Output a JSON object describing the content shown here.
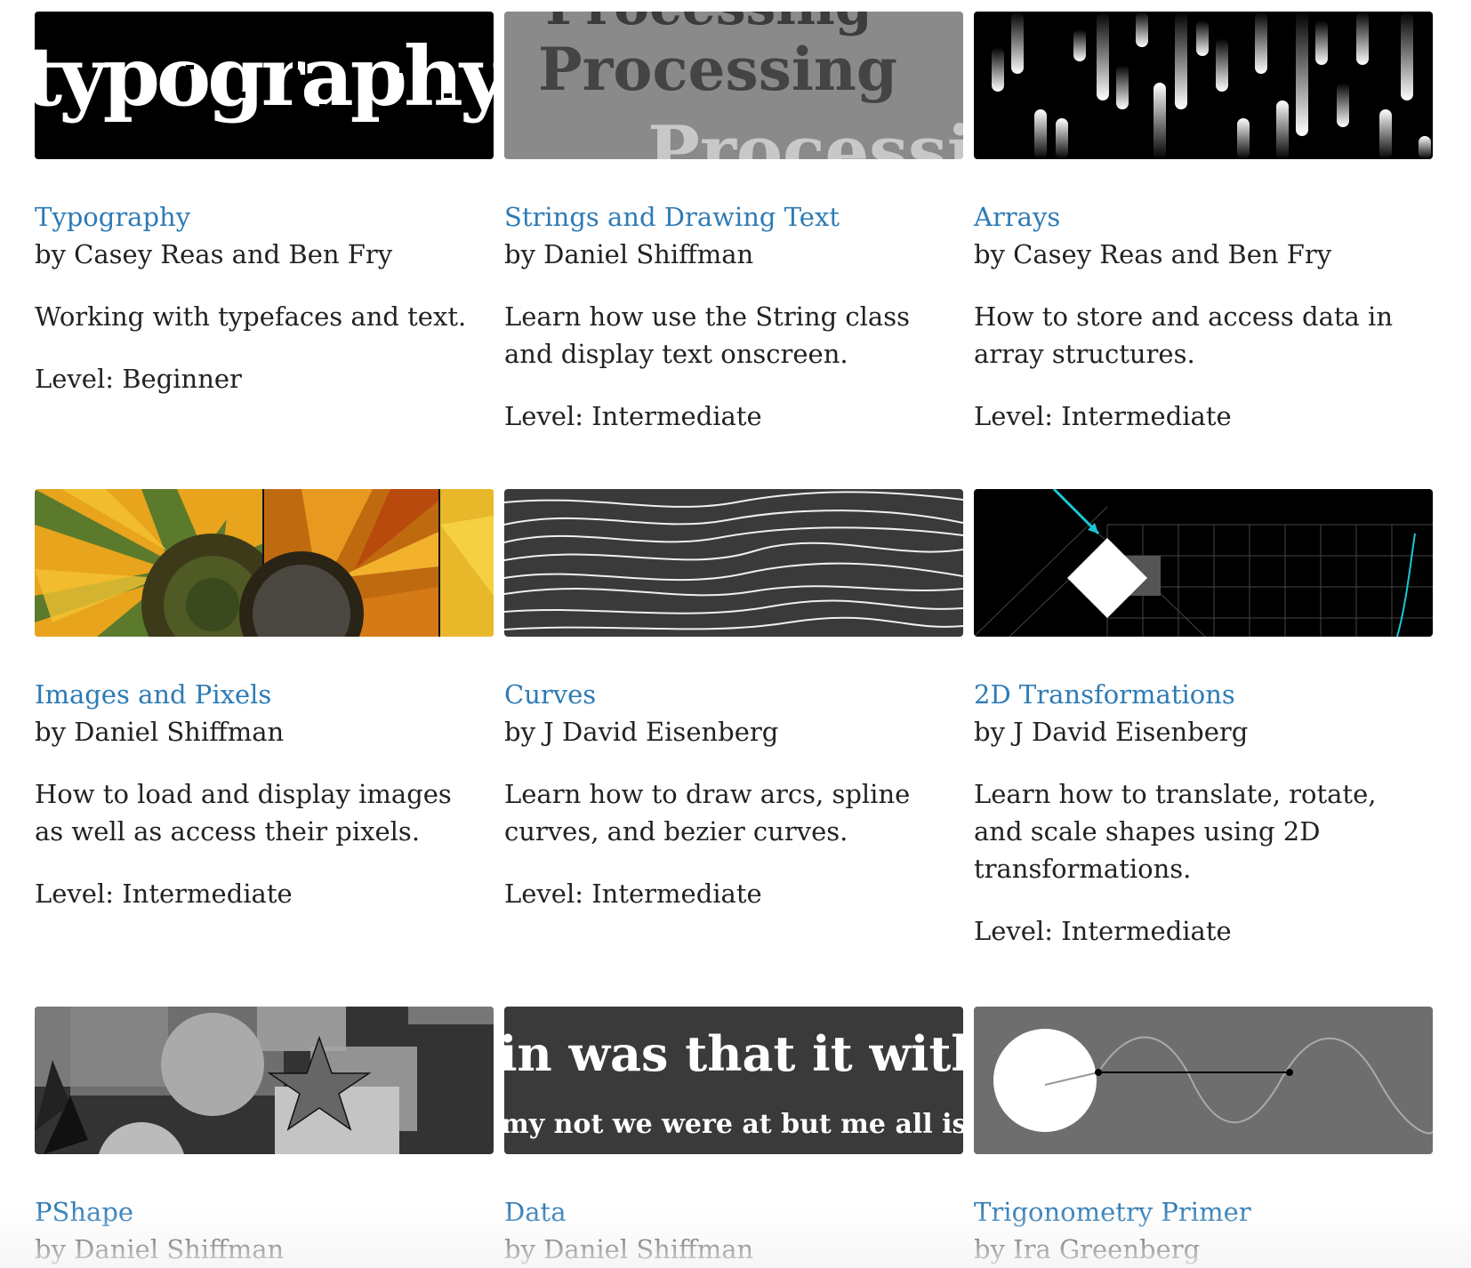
{
  "tutorials": [
    {
      "title": "Typography",
      "author": "by Casey Reas and Ben Fry",
      "description": "Working with typefaces and text.",
      "level": "Level: Beginner",
      "thumb_text": "typography"
    },
    {
      "title": "Strings and Drawing Text",
      "author": "by Daniel Shiffman",
      "description": "Learn how use the String class and display text onscreen.",
      "level": "Level: Intermediate",
      "thumb_text": "Processing"
    },
    {
      "title": "Arrays",
      "author": "by Casey Reas and Ben Fry",
      "description": "How to store and access data in array structures.",
      "level": "Level: Intermediate"
    },
    {
      "title": "Images and Pixels",
      "author": "by Daniel Shiffman",
      "description": "How to load and display images as well as access their pixels.",
      "level": "Level: Intermediate"
    },
    {
      "title": "Curves",
      "author": "by J David Eisenberg",
      "description": "Learn how to draw arcs, spline curves, and bezier curves.",
      "level": "Level: Intermediate"
    },
    {
      "title": "2D Transformations",
      "author": "by J David Eisenberg",
      "description": "Learn how to translate, rotate, and scale shapes using 2D transformations.",
      "level": "Level: Intermediate"
    },
    {
      "title": "PShape",
      "author": "by Daniel Shiffman",
      "description": "",
      "level": ""
    },
    {
      "title": "Data",
      "author": "by Daniel Shiffman",
      "description": "",
      "level": "",
      "thumb_text_1": "in was that it with on as",
      "thumb_text_2": "my not we were at but me all is or them th"
    },
    {
      "title": "Trigonometry Primer",
      "author": "by Ira Greenberg",
      "description": "",
      "level": ""
    }
  ],
  "colors": {
    "link": "#2e7bb5",
    "text": "#222222"
  }
}
